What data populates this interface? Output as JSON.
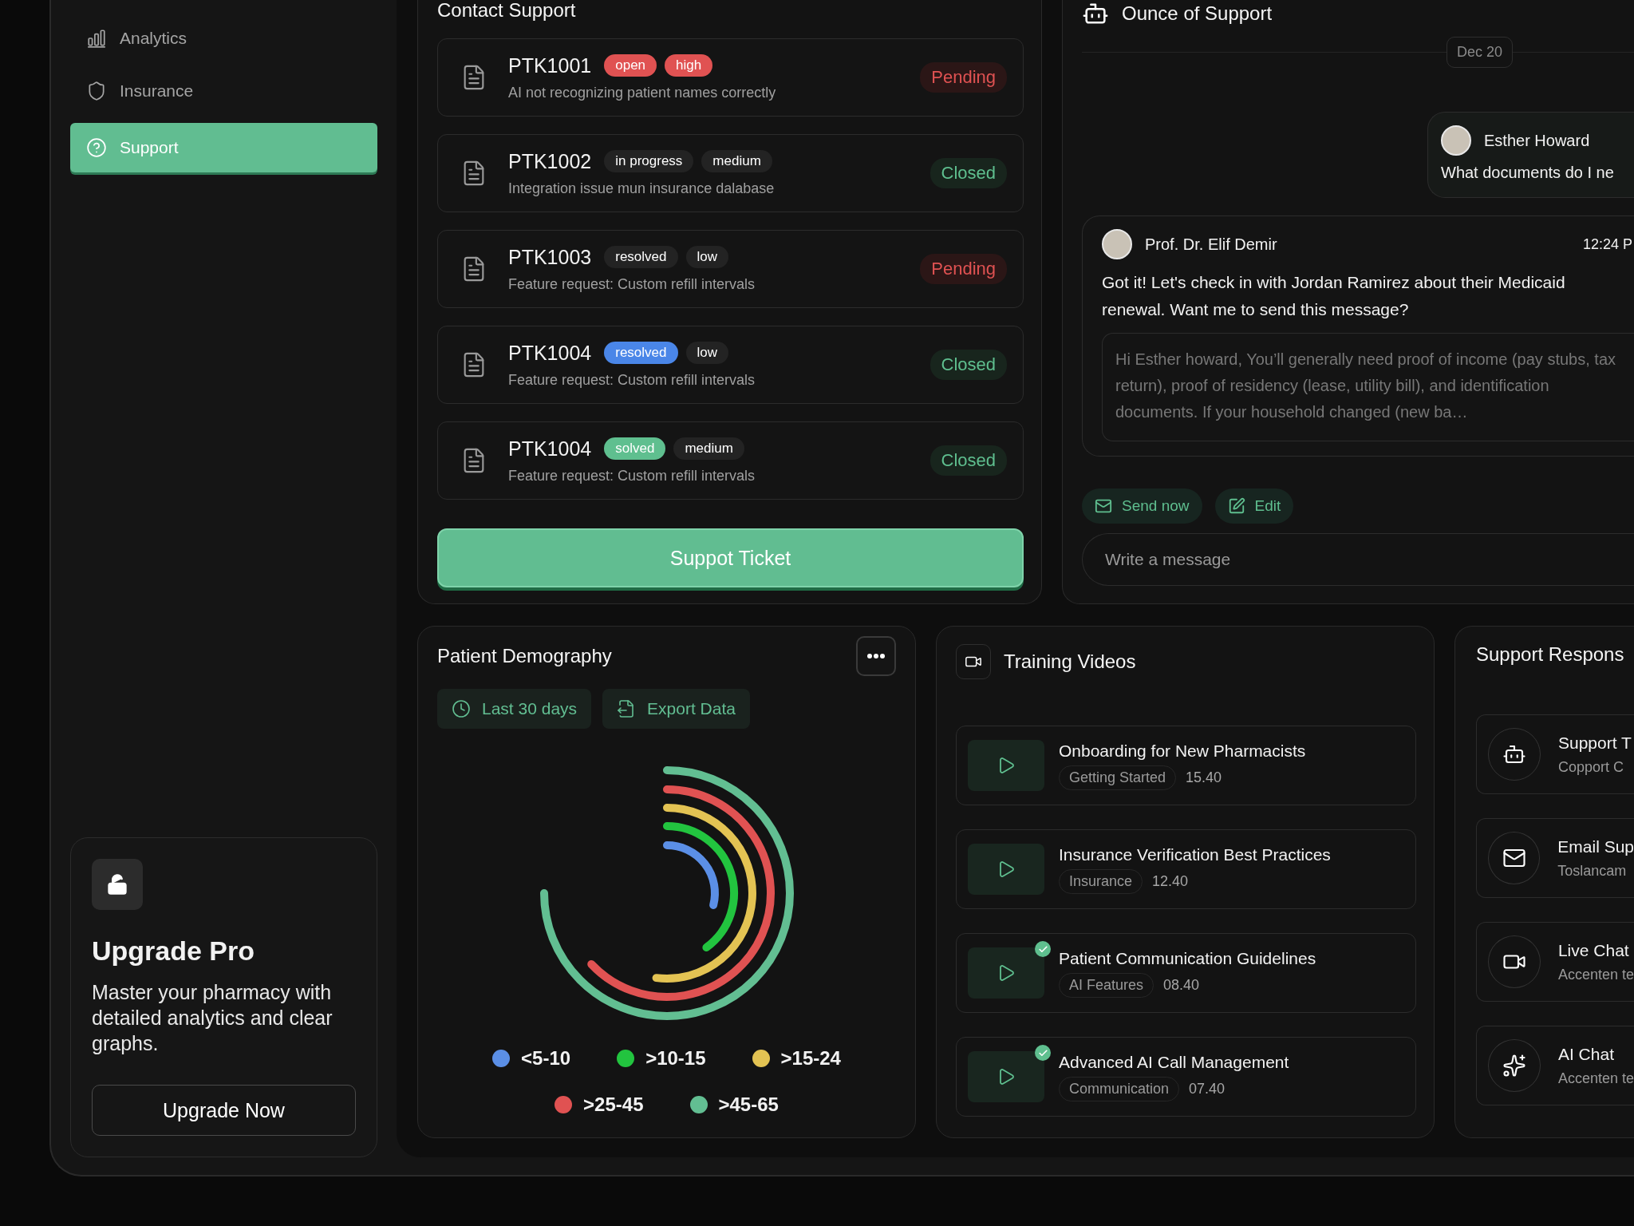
{
  "sidebar": {
    "items": [
      {
        "label": "Analytics",
        "selected": false
      },
      {
        "label": "Insurance",
        "selected": false
      },
      {
        "label": "Support",
        "selected": true
      }
    ],
    "upgrade": {
      "title": "Upgrade Pro",
      "text": "Master your pharmacy with detailed analytics and clear graphs.",
      "button": "Upgrade Now"
    }
  },
  "contact_support": {
    "title": "Contact Support",
    "tickets": [
      {
        "id": "PTK1001",
        "tags": [
          {
            "label": "open",
            "color": "#e05252"
          },
          {
            "label": "high",
            "color": "#e05252"
          }
        ],
        "description": "AI not recognizing patient names correctly",
        "status": {
          "label": "Pending",
          "kind": "pending"
        }
      },
      {
        "id": "PTK1002",
        "tags": [
          {
            "label": "in progress",
            "color": "#232323"
          },
          {
            "label": "medium",
            "color": "#232323"
          }
        ],
        "description": "Integration issue mun insurance dalabase",
        "status": {
          "label": "Closed",
          "kind": "closed"
        }
      },
      {
        "id": "PTK1003",
        "tags": [
          {
            "label": "resolved",
            "color": "#232323"
          },
          {
            "label": "low",
            "color": "#232323"
          }
        ],
        "description": "Feature request: Custom refill intervals",
        "status": {
          "label": "Pending",
          "kind": "pending"
        }
      },
      {
        "id": "PTK1004",
        "tags": [
          {
            "label": "resolved",
            "color": "#4a86e8"
          },
          {
            "label": "low",
            "color": "#232323"
          }
        ],
        "description": "Feature request: Custom refill intervals",
        "status": {
          "label": "Closed",
          "kind": "closed"
        }
      },
      {
        "id": "PTK1004",
        "tags": [
          {
            "label": "solved",
            "color": "#5fbf8f"
          },
          {
            "label": "medium",
            "color": "#232323"
          }
        ],
        "description": "Feature request: Custom refill intervals",
        "status": {
          "label": "Closed",
          "kind": "closed"
        }
      }
    ],
    "button": "Suppot Ticket"
  },
  "chat": {
    "title": "Ounce of Support",
    "date": "Dec 20",
    "question": {
      "name": "Esther Howard",
      "text": "What documents do I ne"
    },
    "reply": {
      "name": "Prof. Dr. Elif Demir",
      "time": "12:24 P",
      "text": "Got it! Let's check in with Jordan Ramirez about their Medicaid renewal. Want me to send this message?",
      "draft": "Hi Esther howard, You’ll generally need proof of income (pay stubs, tax return), proof of residency (lease, utility bill), and identification documents. If your household changed (new ba…"
    },
    "actions": [
      "Send now",
      "Edit"
    ],
    "input": {
      "placeholder": "Write a message"
    }
  },
  "demography": {
    "title": "Patient Demography",
    "filters": [
      "Last 30 days",
      "Export Data"
    ],
    "segments": [
      {
        "label": "<5-10",
        "color": "#5b8fe6"
      },
      {
        "label": ">10-15",
        "color": "#22c43f"
      },
      {
        "label": ">15-24",
        "color": "#e3c353"
      },
      {
        "label": ">25-45",
        "color": "#e05252"
      },
      {
        "label": ">45-65",
        "color": "#62be92"
      }
    ]
  },
  "training_videos": {
    "title": "Training Videos",
    "videos": [
      {
        "title": "Onboarding for New Pharmacists",
        "category": "Getting Started",
        "duration": "15.40",
        "completed": false
      },
      {
        "title": "Insurance Verification Best Practices",
        "category": "Insurance",
        "duration": "12.40",
        "completed": false
      },
      {
        "title": "Patient Communication Guidelines",
        "category": "AI Features",
        "duration": "08.40",
        "completed": true
      },
      {
        "title": "Advanced AI Call Management",
        "category": "Communication",
        "duration": "07.40",
        "completed": true
      }
    ]
  },
  "support_responses": {
    "title": "Support Respons",
    "items": [
      {
        "title": "Support T",
        "subtitle": "Copport C"
      },
      {
        "title": "Email Sup",
        "subtitle": "Toslancam"
      },
      {
        "title": "Live Chat",
        "subtitle": "Accenten te"
      },
      {
        "title": "AI Chat",
        "subtitle": "Accenten te"
      }
    ]
  }
}
